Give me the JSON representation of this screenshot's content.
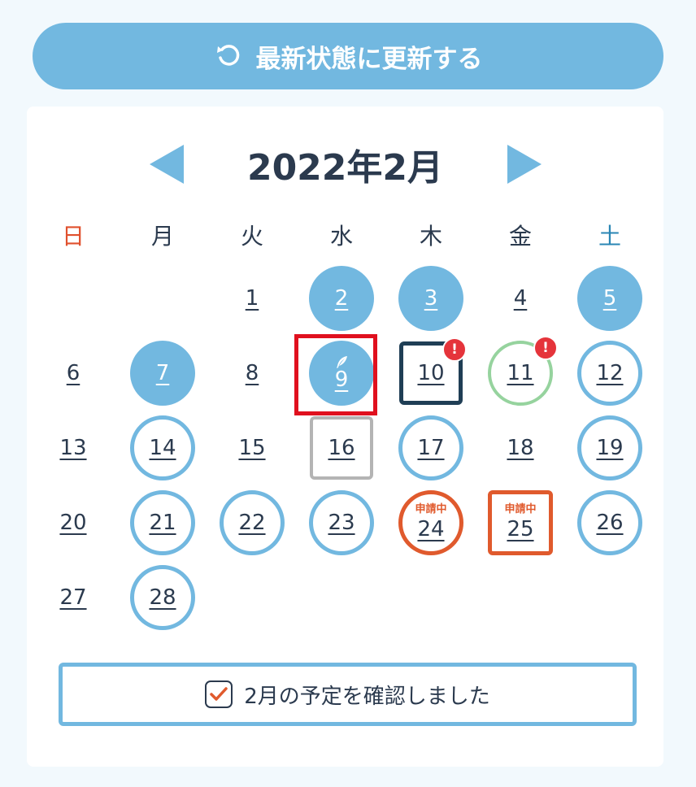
{
  "refresh": {
    "label": "最新状態に更新する",
    "icon": "refresh-icon"
  },
  "calendar": {
    "title": "2022年2月",
    "prev_icon": "triangle-left-icon",
    "next_icon": "triangle-right-icon",
    "weekdays": [
      "日",
      "月",
      "火",
      "水",
      "木",
      "金",
      "土"
    ],
    "weekday_colors": {
      "sunday": "#e0502d",
      "saturday": "#2a86b4"
    },
    "leading_blank_days": 2,
    "days": [
      {
        "num": "1",
        "style": "plain"
      },
      {
        "num": "2",
        "style": "filled"
      },
      {
        "num": "3",
        "style": "filled"
      },
      {
        "num": "4",
        "style": "plain"
      },
      {
        "num": "5",
        "style": "filled"
      },
      {
        "num": "6",
        "style": "plain"
      },
      {
        "num": "7",
        "style": "filled"
      },
      {
        "num": "8",
        "style": "plain"
      },
      {
        "num": "9",
        "style": "filled",
        "selected": true,
        "icon": "feather-icon"
      },
      {
        "num": "10",
        "style": "sq-navy",
        "alert": "!"
      },
      {
        "num": "11",
        "style": "ring-green",
        "alert": "!"
      },
      {
        "num": "12",
        "style": "ring"
      },
      {
        "num": "13",
        "style": "plain"
      },
      {
        "num": "14",
        "style": "ring"
      },
      {
        "num": "15",
        "style": "plain"
      },
      {
        "num": "16",
        "style": "sq-gray"
      },
      {
        "num": "17",
        "style": "ring"
      },
      {
        "num": "18",
        "style": "plain"
      },
      {
        "num": "19",
        "style": "ring"
      },
      {
        "num": "20",
        "style": "plain"
      },
      {
        "num": "21",
        "style": "ring"
      },
      {
        "num": "22",
        "style": "ring"
      },
      {
        "num": "23",
        "style": "ring"
      },
      {
        "num": "24",
        "style": "ring-orange",
        "tag": "申請中"
      },
      {
        "num": "25",
        "style": "sq-orange",
        "tag": "申請中"
      },
      {
        "num": "26",
        "style": "ring"
      },
      {
        "num": "27",
        "style": "plain"
      },
      {
        "num": "28",
        "style": "ring"
      }
    ]
  },
  "confirm": {
    "label": "2月の予定を確認しました",
    "checked": true
  },
  "colors": {
    "accent": "#72b8e0",
    "text": "#2b3a4e",
    "pending": "#e05a2d",
    "alert": "#e5343b",
    "selected_frame": "#e0101e"
  }
}
